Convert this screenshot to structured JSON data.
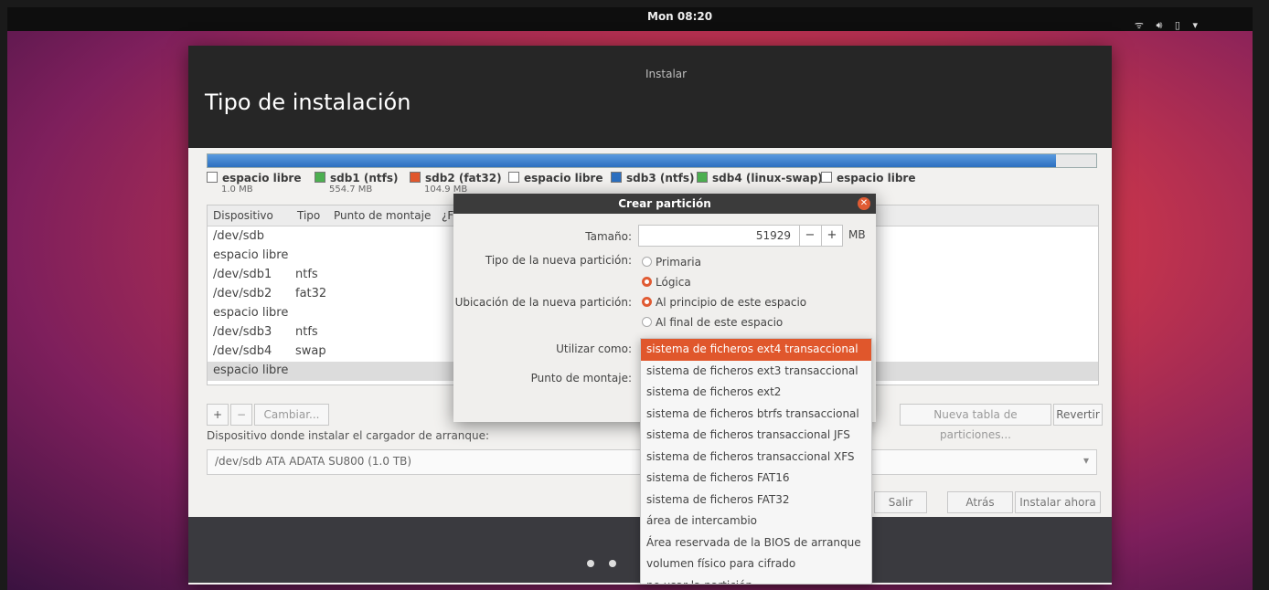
{
  "topbar": {
    "clock": "Mon 08:20",
    "tray_icons": [
      "wifi-icon",
      "volume-icon",
      "battery-icon",
      "dropdown-icon"
    ]
  },
  "window": {
    "title": "Instalar",
    "page_title": "Tipo de instalación",
    "legend": [
      {
        "label": "espacio libre",
        "size": "1.0 MB",
        "color": "#ffffff"
      },
      {
        "label": "sdb1 (ntfs)",
        "size": "554.7 MB",
        "color": "#4caf50"
      },
      {
        "label": "sdb2 (fat32)",
        "size": "104.9 MB",
        "color": "#e0572c"
      },
      {
        "label": "espacio libre",
        "size": "",
        "color": "#ffffff"
      },
      {
        "label": "sdb3 (ntfs)",
        "size": "",
        "color": "#2c6fbf"
      },
      {
        "label": "sdb4 (linux-swap)",
        "size": "",
        "color": "#4caf50"
      },
      {
        "label": "espacio libre",
        "size": "",
        "color": "#ffffff"
      }
    ],
    "table": {
      "headers": [
        "Dispositivo",
        "Tipo",
        "Punto de montaje",
        "¿F"
      ],
      "rows": [
        {
          "device": "/dev/sdb",
          "type": ""
        },
        {
          "device": "espacio libre",
          "type": ""
        },
        {
          "device": "/dev/sdb1",
          "type": "ntfs"
        },
        {
          "device": "/dev/sdb2",
          "type": "fat32"
        },
        {
          "device": "espacio libre",
          "type": ""
        },
        {
          "device": "/dev/sdb3",
          "type": "ntfs"
        },
        {
          "device": "/dev/sdb4",
          "type": "swap"
        },
        {
          "device": "espacio libre",
          "type": ""
        }
      ]
    },
    "tools": {
      "add": "+",
      "remove": "−",
      "change": "Cambiar...",
      "new_table": "Nueva tabla de particiones...",
      "revert": "Revertir"
    },
    "boot_label": "Dispositivo donde instalar el cargador de arranque:",
    "boot_device": "/dev/sdb   ATA ADATA SU800 (1.0 TB)",
    "nav": {
      "quit": "Salir",
      "back": "Atrás",
      "install": "Instalar ahora"
    }
  },
  "dialog": {
    "title": "Crear partición",
    "size_label": "Tamaño:",
    "size_value": "51929",
    "size_unit": "MB",
    "minus": "−",
    "plus": "+",
    "type_label": "Tipo de la nueva partición:",
    "type_options": [
      "Primaria",
      "Lógica"
    ],
    "type_selected": "Lógica",
    "location_label": "Ubicación de la nueva partición:",
    "location_options": [
      "Al principio de este espacio",
      "Al final de este espacio"
    ],
    "location_selected": "Al principio de este espacio",
    "use_label": "Utilizar como:",
    "mount_label": "Punto de montaje:"
  },
  "use_options": [
    "sistema de ficheros ext4 transaccional",
    "sistema de ficheros ext3 transaccional",
    "sistema de ficheros ext2",
    "sistema de ficheros btrfs transaccional",
    "sistema de ficheros transaccional JFS",
    "sistema de ficheros transaccional XFS",
    "sistema de ficheros FAT16",
    "sistema de ficheros FAT32",
    "área de intercambio",
    "Área reservada de la BIOS de arranque",
    "volumen físico para cifrado",
    "no usar la partición"
  ],
  "use_selected_index": 0
}
